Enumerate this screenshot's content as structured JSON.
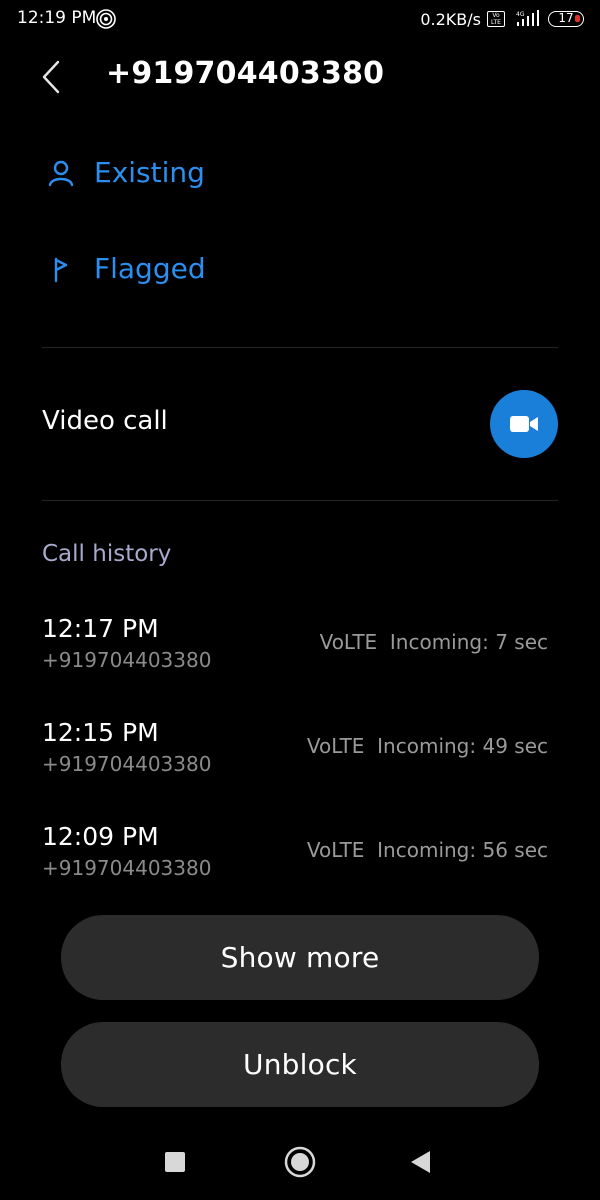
{
  "status_bar": {
    "time": "12:19 PM",
    "net_speed": "0.2KB/s",
    "volte_badge": "Vo LTE",
    "network_type": "4G",
    "battery_level": "17",
    "battery_low_color": "#e0312b"
  },
  "header": {
    "title": "+919704403380",
    "back_icon": "chevron-left-icon"
  },
  "tags": [
    {
      "label": "Existing",
      "icon": "person-icon"
    },
    {
      "label": "Flagged",
      "icon": "flag-icon"
    }
  ],
  "video_call": {
    "label": "Video call",
    "icon": "video-camera-icon",
    "button_color": "#1a7fd8"
  },
  "call_history": {
    "header": "Call history",
    "items": [
      {
        "time": "12:17 PM",
        "number": "+919704403380",
        "detail": "VoLTE  Incoming: 7 sec"
      },
      {
        "time": "12:15 PM",
        "number": "+919704403380",
        "detail": "VoLTE  Incoming: 49 sec"
      },
      {
        "time": "12:09 PM",
        "number": "+919704403380",
        "detail": "VoLTE  Incoming: 56 sec"
      }
    ]
  },
  "actions": {
    "show_more": "Show more",
    "unblock": "Unblock"
  },
  "nav_bar": {
    "recents_icon": "square-icon",
    "home_icon": "circle-icon",
    "back_icon": "triangle-back-icon"
  },
  "colors": {
    "accent": "#2b8ff0",
    "section_header": "#a8a9cc",
    "button_bg": "#2c2c2c"
  }
}
